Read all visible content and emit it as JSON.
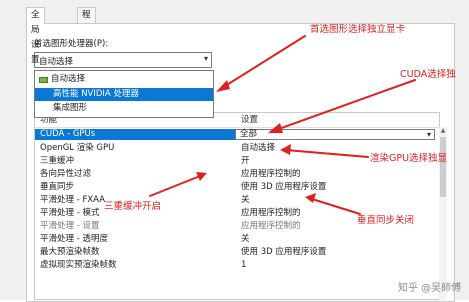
{
  "tabs": [
    {
      "label": "全局设置",
      "active": true
    },
    {
      "label": "程序设置",
      "active": false
    }
  ],
  "preferred_processor": {
    "label": "首选图形处理器(P):",
    "selected": "自动选择"
  },
  "dropdown_options": [
    "自动选择",
    "高性能 NVIDIA 处理器",
    "集成图形"
  ],
  "table": {
    "headers": [
      "功能",
      "设置"
    ],
    "rows": [
      {
        "feature": "CUDA - GPUs",
        "setting": "全部"
      },
      {
        "feature": "OpenGL 渲染 GPU",
        "setting": "自动选择"
      },
      {
        "feature": "三重缓冲",
        "setting": "开"
      },
      {
        "feature": "各向异性过滤",
        "setting": "应用程序控制的"
      },
      {
        "feature": "垂直同步",
        "setting": "使用 3D 应用程序设置"
      },
      {
        "feature": "平滑处理 - FXAA",
        "setting": "关"
      },
      {
        "feature": "平滑处理 - 模式",
        "setting": "应用程序控制的"
      },
      {
        "feature": "平滑处理 - 设置",
        "setting": "应用程序控制的"
      },
      {
        "feature": "平滑处理 - 透明度",
        "setting": "关"
      },
      {
        "feature": "最大预渲染帧数",
        "setting": "使用 3D 应用程序设置"
      },
      {
        "feature": "虚拟现实预渲染帧数",
        "setting": "1"
      }
    ]
  },
  "annotations": {
    "independent_gpu": "首选图形选择独立显卡",
    "cuda": "CUDA选择独",
    "render_gpu": "渲染GPU选择独显",
    "triple_buffer": "三重缓冲开启",
    "vsync": "垂直同步关闭"
  },
  "watermark": "知乎 @吴師傅",
  "colors": {
    "annotation": "#e02020",
    "selection": "#0b78d6"
  }
}
